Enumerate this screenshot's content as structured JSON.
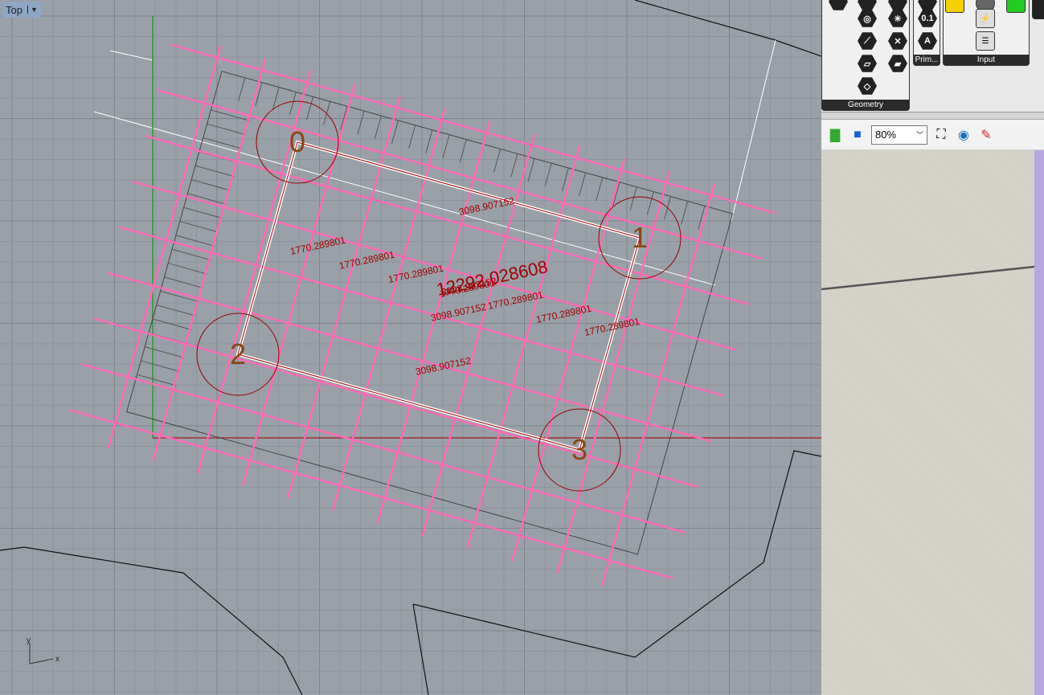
{
  "viewport": {
    "name": "Top",
    "axis_labels": {
      "x": "x",
      "y": "y"
    },
    "point_labels": [
      "0",
      "1",
      "2",
      "3"
    ],
    "dimensions": [
      "3098.907152",
      "1770.289801",
      "1770.289801",
      "1770.289801",
      "3098.907152",
      "12292.028608",
      "1770.289801",
      "3098.907152",
      "1770.289801",
      "1770.289801",
      "1770.289801",
      "3098.907152"
    ],
    "colors": {
      "background": "#9aa0a8",
      "lines": "#ff69b4",
      "text": "#a00000",
      "labels": "#8b4513"
    }
  },
  "panel": {
    "groups": [
      {
        "label": "Geometry"
      },
      {
        "label": "Prim..."
      },
      {
        "label": "Input"
      }
    ],
    "toolbar": {
      "zoom": "80%",
      "open_icon": "folder-icon",
      "save_icon": "save-icon",
      "zoom_extents_icon": "zoom-extents-icon",
      "preview_icon": "eye-icon",
      "sketch_icon": "pen-icon"
    }
  }
}
